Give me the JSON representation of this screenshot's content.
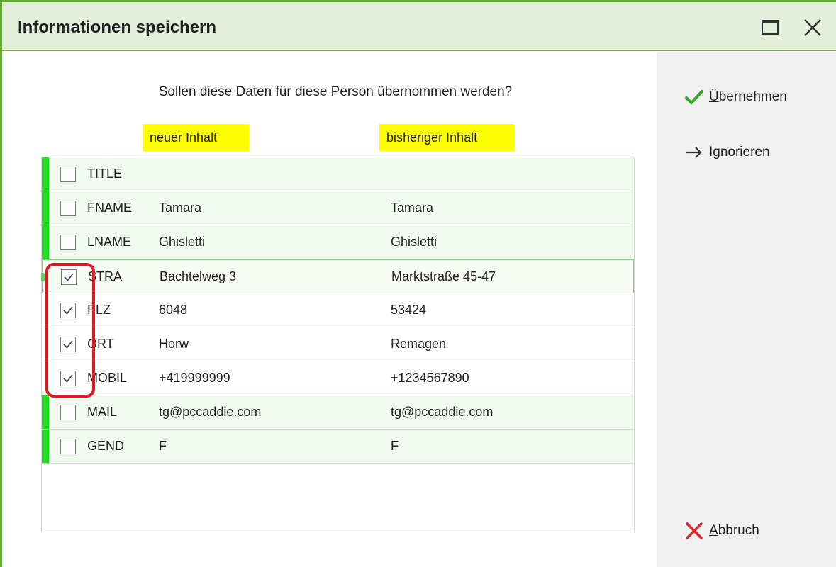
{
  "window": {
    "title": "Informationen speichern"
  },
  "prompt": {
    "question": "Sollen diese Daten für diese Person übernommen werden?",
    "new_header": "neuer Inhalt",
    "old_header": "bisheriger Inhalt"
  },
  "rows": [
    {
      "field": "TITLE",
      "new": "",
      "old": "",
      "checked": false
    },
    {
      "field": "FNAME",
      "new": "Tamara",
      "old": "Tamara",
      "checked": false
    },
    {
      "field": "LNAME",
      "new": "Ghisletti",
      "old": "Ghisletti",
      "checked": false
    },
    {
      "field": "STRA",
      "new": "Bachtelweg 3",
      "old": "Marktstraße 45-47",
      "checked": true
    },
    {
      "field": "PLZ",
      "new": "6048",
      "old": "53424",
      "checked": true
    },
    {
      "field": "ORT",
      "new": "Horw",
      "old": "Remagen",
      "checked": true
    },
    {
      "field": "MOBIL",
      "new": "+419999999",
      "old": "+1234567890",
      "checked": true
    },
    {
      "field": "MAIL",
      "new": "tg@pccaddie.com",
      "old": "tg@pccaddie.com",
      "checked": false
    },
    {
      "field": "GEND",
      "new": "F",
      "old": "F",
      "checked": false
    }
  ],
  "actions": {
    "accept": {
      "label_first": "Ü",
      "label_rest": "bernehmen",
      "icon": "checkmark-icon"
    },
    "ignore": {
      "label_first": "I",
      "label_rest": "gnorieren",
      "icon": "arrow-right-icon"
    },
    "cancel": {
      "label_first": "A",
      "label_rest": "bbruch",
      "icon": "cross-icon"
    }
  },
  "colors": {
    "accent_green": "#6aaa3a",
    "header_highlight": "#ffff00",
    "annotation_red": "#e8141e",
    "checkmark_green": "#2ea82e",
    "cancel_red": "#e0202a"
  }
}
